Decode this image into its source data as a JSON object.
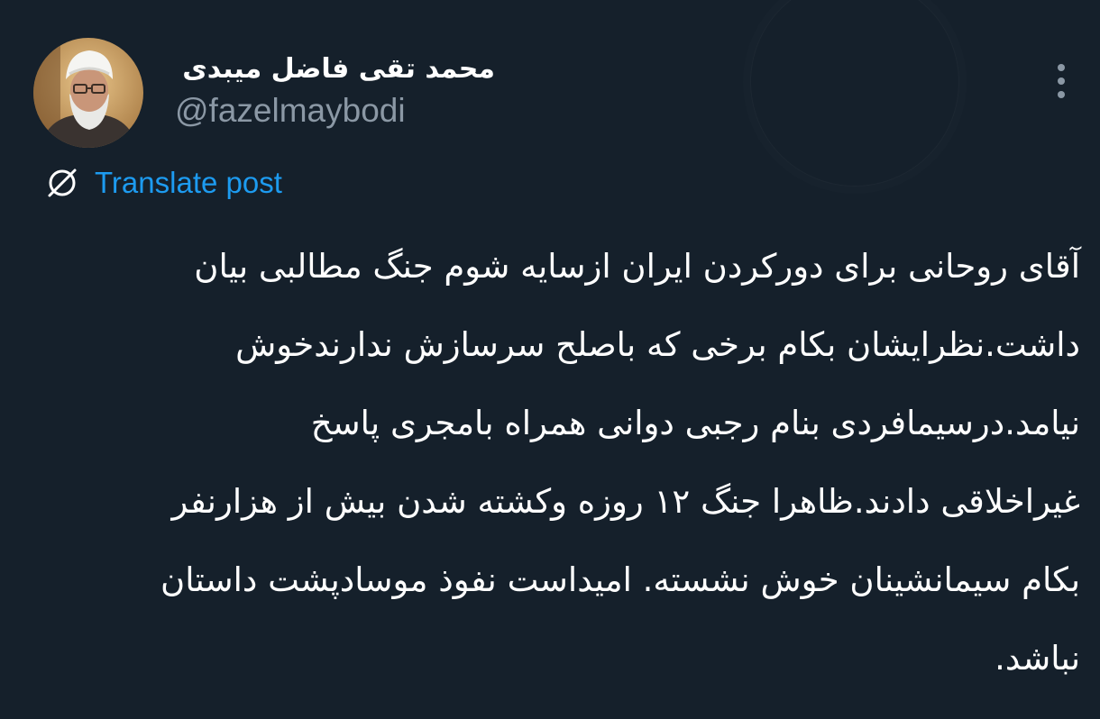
{
  "theme": {
    "background": "#15202b",
    "text_primary": "#ffffff",
    "text_secondary": "#8b98a5",
    "accent": "#1d9bf0"
  },
  "author": {
    "display_name": "محمد تقی فاضل میبدی",
    "handle": "@fazelmaybodi",
    "avatar_icon": "profile-photo"
  },
  "actions": {
    "more_icon": "more-vertical-icon",
    "translate_icon": "globe-slash-icon",
    "translate_label": "Translate post"
  },
  "post": {
    "lines": [
      "آقای روحانی برای دورکردن ایران ازسایه شوم جنگ مطالبی بیان",
      "داشت.نظرایشان بکام برخی که باصلح سرسازش ندارندخوش",
      "نیامد.درسیمافردی بنام رجبی دوانی همراه بامجری پاسخ",
      "غیراخلاقی دادند.ظاهرا جنگ ۱۲ روزه وکشته شدن بیش از هزارنفر",
      "بکام سیمانشینان خوش نشسته. امیداست نفوذ موسادپشت داستان",
      "نباشد."
    ]
  }
}
